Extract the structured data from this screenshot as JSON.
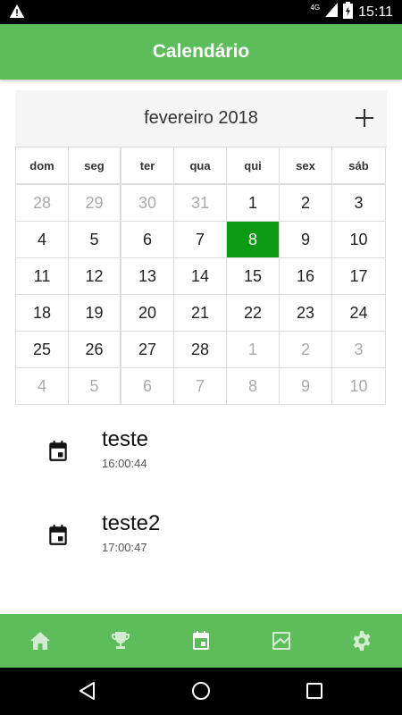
{
  "status_bar": {
    "network": "4G",
    "time": "15:11",
    "icons": [
      "warning-icon",
      "signal-icon",
      "battery-charging-icon"
    ]
  },
  "app_bar": {
    "title": "Calendário"
  },
  "calendar": {
    "month_title": "fevereiro 2018",
    "add_icon": "plus-icon",
    "weekdays": [
      "dom",
      "seg",
      "ter",
      "qua",
      "qui",
      "sex",
      "sáb"
    ],
    "weeks": [
      [
        "28",
        "29",
        "30",
        "31",
        "1",
        "2",
        "3"
      ],
      [
        "4",
        "5",
        "6",
        "7",
        "8",
        "9",
        "10"
      ],
      [
        "11",
        "12",
        "13",
        "14",
        "15",
        "16",
        "17"
      ],
      [
        "18",
        "19",
        "20",
        "21",
        "22",
        "23",
        "24"
      ],
      [
        "25",
        "26",
        "27",
        "28",
        "1",
        "2",
        "3"
      ],
      [
        "4",
        "5",
        "6",
        "7",
        "8",
        "9",
        "10"
      ]
    ],
    "selected_day": "8",
    "selected_color": "#0b9a12"
  },
  "events": [
    {
      "title": "teste",
      "time": "16:00:44",
      "icon": "event-icon"
    },
    {
      "title": "teste2",
      "time": "17:00:47",
      "icon": "event-icon"
    }
  ],
  "bottom_nav": {
    "items": [
      "home-icon",
      "trophy-icon",
      "event-icon",
      "chart-icon",
      "gear-icon"
    ],
    "active": "event-icon",
    "color": "#5cbd5a"
  },
  "system_nav": [
    "back-icon",
    "home-circle-icon",
    "recents-icon"
  ]
}
